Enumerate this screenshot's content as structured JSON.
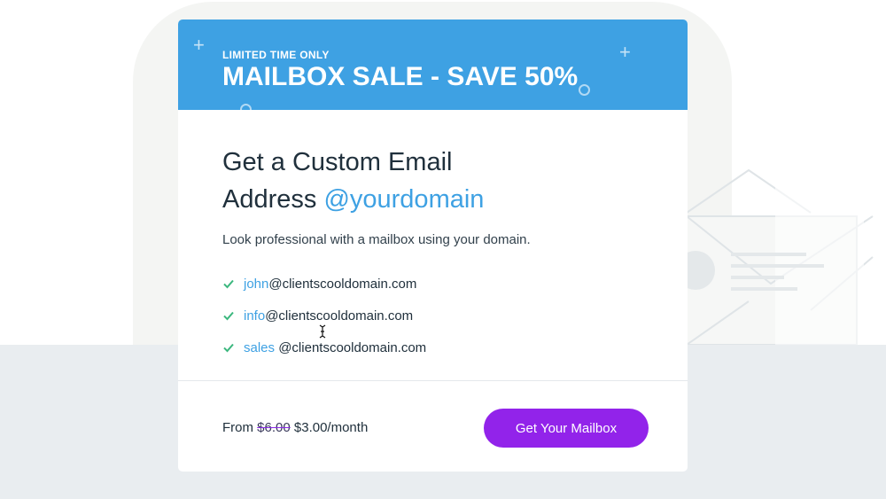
{
  "banner": {
    "eyebrow": "LIMITED TIME ONLY",
    "title": "MAILBOX SALE - SAVE 50%"
  },
  "headline": {
    "line1": "Get a Custom Email",
    "line2_prefix": "Address",
    "line2_accent": "@yourdomain"
  },
  "subtitle": "Look professional with a mailbox using your domain.",
  "features": [
    {
      "user": "john",
      "domain": "@clientscooldomain.com"
    },
    {
      "user": "info",
      "domain": "@clientscooldomain.com"
    },
    {
      "user": "sales",
      "domain": "@clientscooldomain.com"
    }
  ],
  "pricing": {
    "prefix": "From",
    "old_price": "$6.00",
    "new_price": "$3.00/month"
  },
  "cta_label": "Get Your Mailbox",
  "colors": {
    "banner_blue": "#3ea1e3",
    "accent_blue": "#3ea1e3",
    "cta_purple": "#9223ea",
    "check_green": "#3bb77e",
    "text_dark": "#20303c"
  },
  "icons": [
    "plus-icon",
    "circle-icon",
    "check-icon",
    "envelope-illustration",
    "text-cursor-icon"
  ]
}
